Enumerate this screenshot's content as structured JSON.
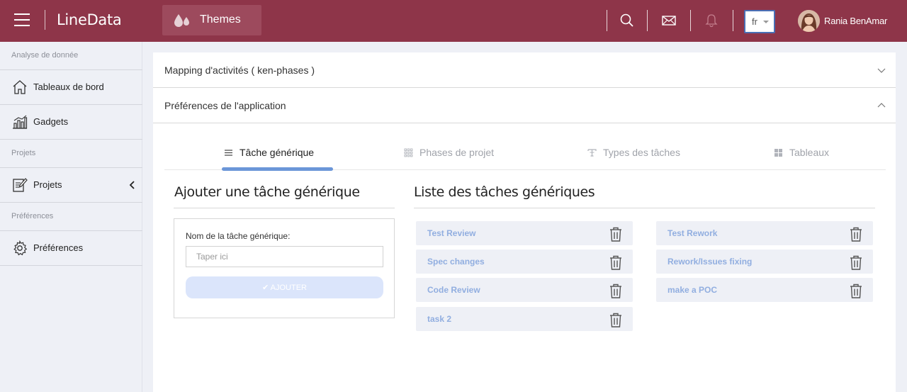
{
  "app": {
    "title": "LineData"
  },
  "header": {
    "themes_label": "Themes",
    "language": "fr",
    "user_name": "Rania BenAmar",
    "icons": [
      "menu-icon",
      "drops-icon",
      "search-icon",
      "mail-icon",
      "bell-icon"
    ]
  },
  "sidebar": {
    "sections": [
      {
        "label": "Analyse de donnée"
      },
      {
        "label": "Projets"
      },
      {
        "label": "Préférences"
      }
    ],
    "items": [
      {
        "label": "Tableaux de bord",
        "icon": "home-icon"
      },
      {
        "label": "Gadgets",
        "icon": "bar-chart-icon"
      },
      {
        "label": "Projets",
        "icon": "edit-document-icon"
      },
      {
        "label": "Préférences",
        "icon": "gear-icon"
      }
    ]
  },
  "accordion": [
    {
      "title": "Mapping d'activités ( ken-phases )",
      "expanded": false
    },
    {
      "title": "Préférences de l'application",
      "expanded": true
    }
  ],
  "tabs": [
    {
      "label": "Tâche générique",
      "icon": "list-icon",
      "active": true
    },
    {
      "label": "Phases de projet",
      "icon": "grid-dots-icon",
      "active": false
    },
    {
      "label": "Types des tâches",
      "icon": "type-icon",
      "active": false
    },
    {
      "label": "Tableaux",
      "icon": "squares-icon",
      "active": false
    }
  ],
  "add_form": {
    "heading": "Ajouter une tâche générique",
    "field_label": "Nom de la tâche générique:",
    "placeholder": "Taper ici",
    "value": "",
    "button_label": "AJOUTER"
  },
  "task_list": {
    "heading": "Liste des tâches génériques",
    "left": [
      "Test Review",
      "Spec changes",
      "Code Review",
      "task 2"
    ],
    "right": [
      "Test Rework",
      "Rework/Issues fixing",
      "make a POC"
    ]
  },
  "colors": {
    "header_bg": "#8e3549",
    "accent": "#6b96d8",
    "task_text": "#91aee0",
    "button_disabled": "#dbe5fb"
  }
}
